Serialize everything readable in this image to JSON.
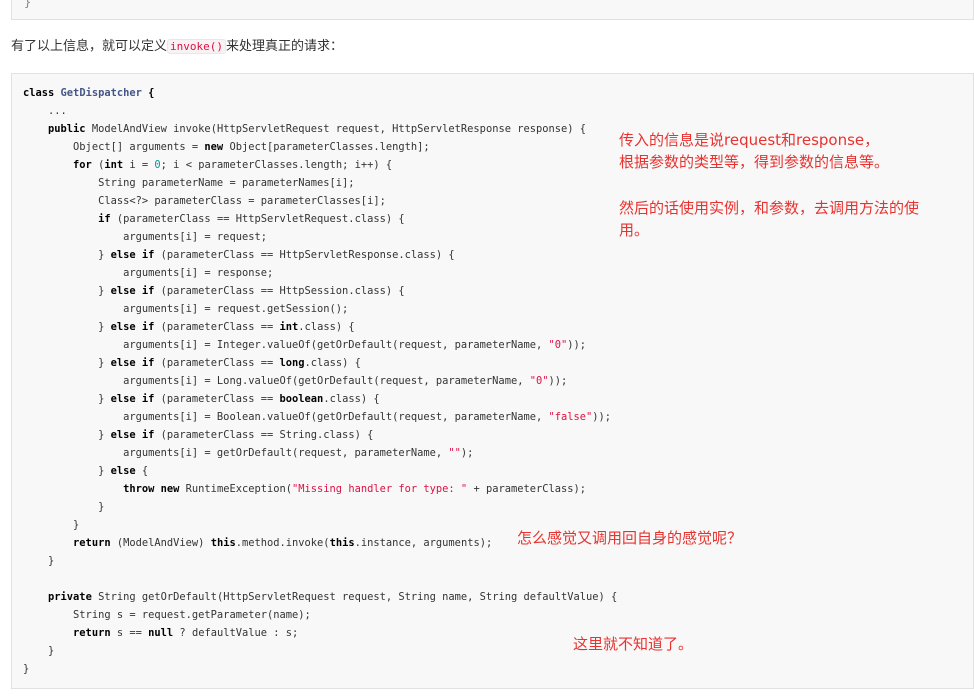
{
  "previous_block": {
    "text": "}"
  },
  "intro": {
    "before": "有了以上信息，就可以定义",
    "code": "invoke()",
    "after": "来处理真正的请求："
  },
  "code": {
    "lines": [
      [
        {
          "t": "kw",
          "v": "class "
        },
        {
          "t": "ty",
          "v": "GetDispatcher"
        },
        {
          "t": "kw",
          "v": " {"
        }
      ],
      [
        {
          "t": "p",
          "v": "    ..."
        }
      ],
      [
        {
          "t": "p",
          "v": "    "
        },
        {
          "t": "kw",
          "v": "public"
        },
        {
          "t": "p",
          "v": " ModelAndView invoke(HttpServletRequest request, HttpServletResponse response) {"
        }
      ],
      [
        {
          "t": "p",
          "v": "        Object[] arguments = "
        },
        {
          "t": "kw",
          "v": "new"
        },
        {
          "t": "p",
          "v": " Object[parameterClasses.length];"
        }
      ],
      [
        {
          "t": "p",
          "v": "        "
        },
        {
          "t": "kw",
          "v": "for"
        },
        {
          "t": "p",
          "v": " ("
        },
        {
          "t": "kw",
          "v": "int"
        },
        {
          "t": "p",
          "v": " i = "
        },
        {
          "t": "num",
          "v": "0"
        },
        {
          "t": "p",
          "v": "; i < parameterClasses.length; i++) {"
        }
      ],
      [
        {
          "t": "p",
          "v": "            String parameterName = parameterNames[i];"
        }
      ],
      [
        {
          "t": "p",
          "v": "            Class<?> parameterClass = parameterClasses[i];"
        }
      ],
      [
        {
          "t": "p",
          "v": "            "
        },
        {
          "t": "kw",
          "v": "if"
        },
        {
          "t": "p",
          "v": " (parameterClass == HttpServletRequest.class) {"
        }
      ],
      [
        {
          "t": "p",
          "v": "                arguments[i] = request;"
        }
      ],
      [
        {
          "t": "p",
          "v": "            } "
        },
        {
          "t": "kw",
          "v": "else if"
        },
        {
          "t": "p",
          "v": " (parameterClass == HttpServletResponse.class) {"
        }
      ],
      [
        {
          "t": "p",
          "v": "                arguments[i] = response;"
        }
      ],
      [
        {
          "t": "p",
          "v": "            } "
        },
        {
          "t": "kw",
          "v": "else if"
        },
        {
          "t": "p",
          "v": " (parameterClass == HttpSession.class) {"
        }
      ],
      [
        {
          "t": "p",
          "v": "                arguments[i] = request.getSession();"
        }
      ],
      [
        {
          "t": "p",
          "v": "            } "
        },
        {
          "t": "kw",
          "v": "else if"
        },
        {
          "t": "p",
          "v": " (parameterClass == "
        },
        {
          "t": "kw",
          "v": "int"
        },
        {
          "t": "p",
          "v": ".class) {"
        }
      ],
      [
        {
          "t": "p",
          "v": "                arguments[i] = Integer.valueOf(getOrDefault(request, parameterName, "
        },
        {
          "t": "str",
          "v": "\"0\""
        },
        {
          "t": "p",
          "v": "));"
        }
      ],
      [
        {
          "t": "p",
          "v": "            } "
        },
        {
          "t": "kw",
          "v": "else if"
        },
        {
          "t": "p",
          "v": " (parameterClass == "
        },
        {
          "t": "kw",
          "v": "long"
        },
        {
          "t": "p",
          "v": ".class) {"
        }
      ],
      [
        {
          "t": "p",
          "v": "                arguments[i] = Long.valueOf(getOrDefault(request, parameterName, "
        },
        {
          "t": "str",
          "v": "\"0\""
        },
        {
          "t": "p",
          "v": "));"
        }
      ],
      [
        {
          "t": "p",
          "v": "            } "
        },
        {
          "t": "kw",
          "v": "else if"
        },
        {
          "t": "p",
          "v": " (parameterClass == "
        },
        {
          "t": "kw",
          "v": "boolean"
        },
        {
          "t": "p",
          "v": ".class) {"
        }
      ],
      [
        {
          "t": "p",
          "v": "                arguments[i] = Boolean.valueOf(getOrDefault(request, parameterName, "
        },
        {
          "t": "str",
          "v": "\"false\""
        },
        {
          "t": "p",
          "v": "));"
        }
      ],
      [
        {
          "t": "p",
          "v": "            } "
        },
        {
          "t": "kw",
          "v": "else if"
        },
        {
          "t": "p",
          "v": " (parameterClass == String.class) {"
        }
      ],
      [
        {
          "t": "p",
          "v": "                arguments[i] = getOrDefault(request, parameterName, "
        },
        {
          "t": "str",
          "v": "\"\""
        },
        {
          "t": "p",
          "v": ");"
        }
      ],
      [
        {
          "t": "p",
          "v": "            } "
        },
        {
          "t": "kw",
          "v": "else"
        },
        {
          "t": "p",
          "v": " {"
        }
      ],
      [
        {
          "t": "p",
          "v": "                "
        },
        {
          "t": "kw",
          "v": "throw new"
        },
        {
          "t": "p",
          "v": " RuntimeException("
        },
        {
          "t": "str",
          "v": "\"Missing handler for type: \""
        },
        {
          "t": "p",
          "v": " + parameterClass);"
        }
      ],
      [
        {
          "t": "p",
          "v": "            }"
        }
      ],
      [
        {
          "t": "p",
          "v": "        }"
        }
      ],
      [
        {
          "t": "p",
          "v": "        "
        },
        {
          "t": "kw",
          "v": "return"
        },
        {
          "t": "p",
          "v": " (ModelAndView) "
        },
        {
          "t": "kw",
          "v": "this"
        },
        {
          "t": "p",
          "v": ".method.invoke("
        },
        {
          "t": "kw",
          "v": "this"
        },
        {
          "t": "p",
          "v": ".instance, arguments);"
        }
      ],
      [
        {
          "t": "p",
          "v": "    }"
        }
      ],
      [
        {
          "t": "p",
          "v": ""
        }
      ],
      [
        {
          "t": "p",
          "v": "    "
        },
        {
          "t": "kw",
          "v": "private"
        },
        {
          "t": "p",
          "v": " String getOrDefault(HttpServletRequest request, String name, String defaultValue) {"
        }
      ],
      [
        {
          "t": "p",
          "v": "        String s = request.getParameter(name);"
        }
      ],
      [
        {
          "t": "p",
          "v": "        "
        },
        {
          "t": "kw",
          "v": "return"
        },
        {
          "t": "p",
          "v": " s == "
        },
        {
          "t": "kw",
          "v": "null"
        },
        {
          "t": "p",
          "v": " ? defaultValue : s;"
        }
      ],
      [
        {
          "t": "p",
          "v": "    }"
        }
      ],
      [
        {
          "t": "p",
          "v": "}"
        }
      ]
    ]
  },
  "annotations": {
    "note1_line1": "传入的信息是说request和response，",
    "note1_line2": "根据参数的类型等，得到参数的信息等。",
    "note2_line1": "然后的话使用实例，和参数，去调用方法的使",
    "note2_line2": "用。",
    "note3": "怎么感觉又调用回自身的感觉呢？",
    "note4": "这里就不知道了。",
    "color": "#e8322f"
  }
}
